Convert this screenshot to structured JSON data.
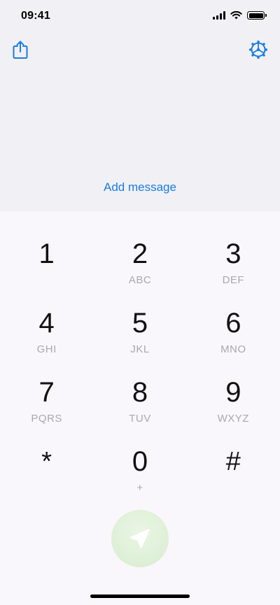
{
  "status_bar": {
    "time": "09:41"
  },
  "header": {
    "share_icon": "share-icon",
    "settings_icon": "gear-icon"
  },
  "message": {
    "add_label": "Add message"
  },
  "keypad": [
    {
      "digit": "1",
      "letters": ""
    },
    {
      "digit": "2",
      "letters": "ABC"
    },
    {
      "digit": "3",
      "letters": "DEF"
    },
    {
      "digit": "4",
      "letters": "GHI"
    },
    {
      "digit": "5",
      "letters": "JKL"
    },
    {
      "digit": "6",
      "letters": "MNO"
    },
    {
      "digit": "7",
      "letters": "PQRS"
    },
    {
      "digit": "8",
      "letters": "TUV"
    },
    {
      "digit": "9",
      "letters": "WXYZ"
    },
    {
      "digit": "*",
      "letters": ""
    },
    {
      "digit": "0",
      "letters": "+"
    },
    {
      "digit": "#",
      "letters": ""
    }
  ],
  "colors": {
    "accent": "#1a7de0",
    "send_button": "#dff0d8",
    "send_icon": "#ffffff"
  },
  "send_button": {
    "icon": "send-arrow-icon"
  }
}
